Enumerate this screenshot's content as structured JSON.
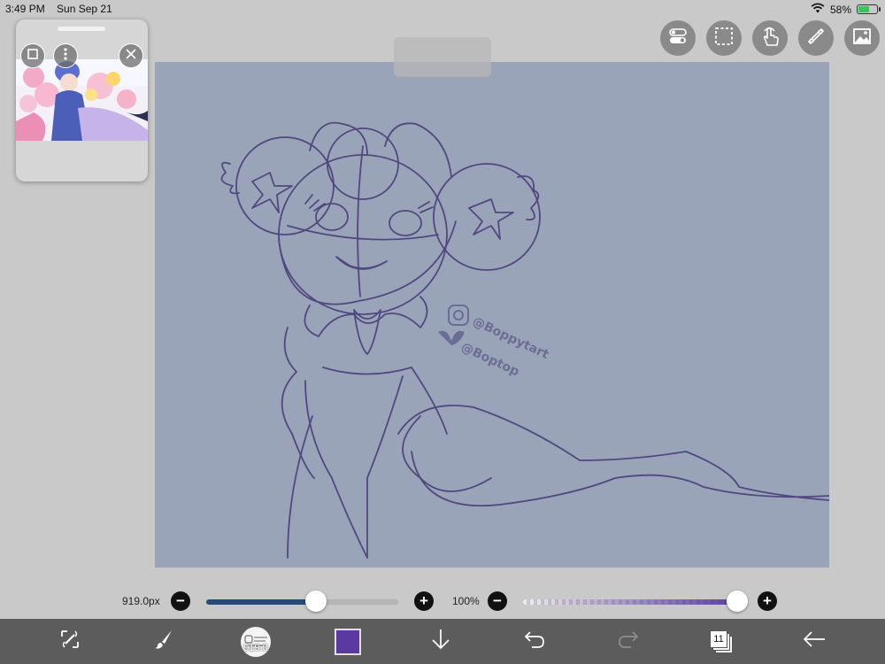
{
  "status_bar": {
    "time": "3:49 PM",
    "date": "Sun Sep 21",
    "battery_percent_label": "58%",
    "battery_level": 0.58,
    "icons": [
      "wifi-icon",
      "battery-charging-icon"
    ]
  },
  "reference_panel": {
    "icons": [
      "square-icon",
      "more-vertical-icon",
      "close-icon"
    ]
  },
  "top_tools": [
    {
      "name": "toggle-tool",
      "icon": "toggle-icon"
    },
    {
      "name": "selection-tool",
      "icon": "dashed-selection-icon"
    },
    {
      "name": "touch-tool",
      "icon": "hand-pointer-icon"
    },
    {
      "name": "ruler-tool",
      "icon": "ruler-icon"
    },
    {
      "name": "material-tool",
      "icon": "image-icon"
    }
  ],
  "canvas": {
    "watermark_lines": [
      "@Boppytart",
      "@Boptop"
    ],
    "background_color": "#9aa4b8",
    "stroke_color": "#4a3f7a"
  },
  "brush_slider": {
    "value_label": "919.0px",
    "level": 0.57,
    "minus": "−",
    "plus": "+",
    "track_color": "#274a7a"
  },
  "opacity_slider": {
    "value_label": "100%",
    "level": 1.0,
    "minus": "−",
    "plus": "+",
    "track_color": "#5a3fa0"
  },
  "bottom_toolbar": {
    "brush_preview_label": "919.0",
    "current_color": "#5a3aa0",
    "layer_count": "11",
    "icons": [
      "transform-icon",
      "brush-icon",
      "brush-preview-icon",
      "color-swatch",
      "arrow-down-icon",
      "undo-icon",
      "redo-icon",
      "layers-icon",
      "back-arrow-icon"
    ]
  }
}
